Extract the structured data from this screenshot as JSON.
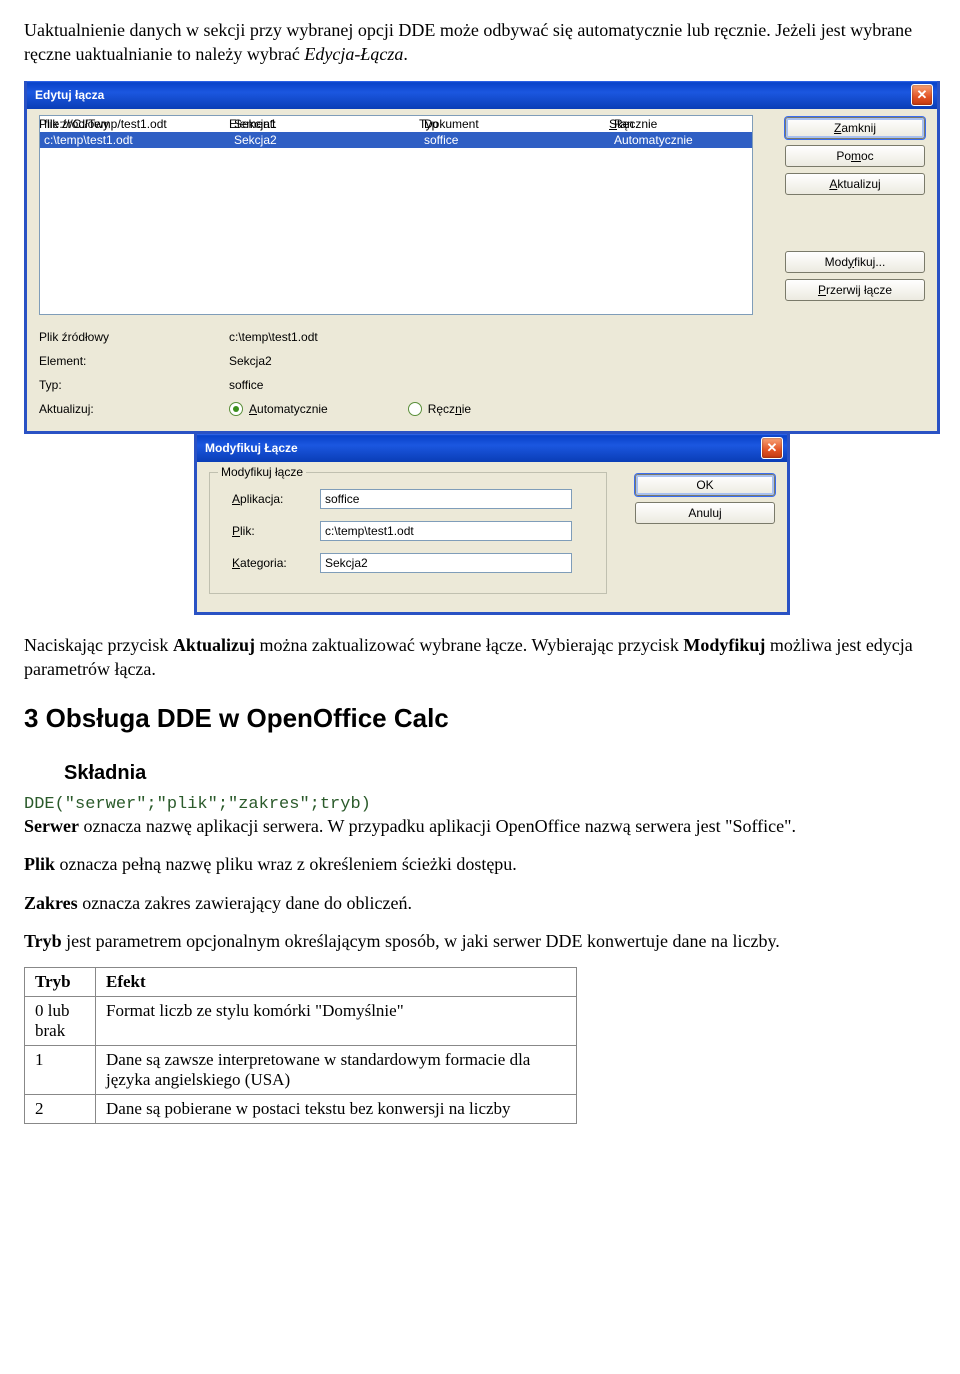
{
  "intro": {
    "p1a": "Uaktualnienie danych w sekcji przy wybranej opcji DDE może odbywać się automatycznie lub ręcznie. Jeżeli jest wybrane ręczne uaktualnianie to należy wybrać ",
    "p1b": "Edycja-Łącza",
    "p1c": "."
  },
  "dialog1": {
    "title": "Edytuj łącza",
    "headers": {
      "source": "Plik źródłowy",
      "element": "Element:",
      "typ": "Typ",
      "stan": "Stan"
    },
    "rows": [
      {
        "source": "file:///C:/Temp/test1.odt",
        "element": "Sekcja1",
        "typ": "Dokument",
        "stan": "Ręcznie"
      },
      {
        "source": "c:\\temp\\test1.odt",
        "element": "Sekcja2",
        "typ": "soffice",
        "stan": "Automatycznie"
      }
    ],
    "buttons": {
      "close": "Zamknij",
      "help": "Pomoc",
      "update": "Aktualizuj",
      "modify": "Modyfikuj...",
      "break": "Przerwij łącze"
    },
    "details": {
      "source_label": "Plik źródłowy",
      "source_val": "c:\\temp\\test1.odt",
      "element_label": "Element:",
      "element_val": "Sekcja2",
      "typ_label": "Typ:",
      "typ_val": "soffice",
      "update_label": "Aktualizuj:",
      "radio_auto": "Automatycznie",
      "radio_manual": "Ręcznie"
    }
  },
  "dialog2": {
    "title": "Modyfikuj Łącze",
    "legend": "Modyfikuj łącze",
    "app_label": "Aplikacja:",
    "app_val": "soffice",
    "file_label": "Plik:",
    "file_val": "c:\\temp\\test1.odt",
    "cat_label": "Kategoria:",
    "cat_val": "Sekcja2",
    "ok": "OK",
    "cancel": "Anuluj"
  },
  "after": {
    "p2a": "Naciskając przycisk ",
    "p2b": "Aktualizuj",
    "p2c": " można zaktualizować wybrane łącze. Wybierając przycisk ",
    "p2d": "Modyfikuj",
    "p2e": " możliwa jest edycja parametrów łącza.",
    "h2": "3  Obsługa DDE w OpenOffice Calc",
    "h3": "Składnia",
    "code": "DDE(\"serwer\";\"plik\";\"zakres\";tryb)",
    "p_serwer_a": "Serwer",
    "p_serwer_b": " oznacza nazwę aplikacji serwera. W przypadku aplikacji OpenOffice nazwą serwera jest \"Soffice\".",
    "p_plik_a": "Plik",
    "p_plik_b": " oznacza pełną nazwę pliku wraz z określeniem ścieżki dostępu.",
    "p_zak_a": "Zakres",
    "p_zak_b": " oznacza zakres zawierający dane do obliczeń.",
    "p_tryb_a": "Tryb",
    "p_tryb_b": " jest parametrem opcjonalnym określającym sposób, w jaki serwer DDE konwertuje dane na liczby."
  },
  "table": {
    "th0": "Tryb",
    "th1": "Efekt",
    "r1c0": "0 lub brak",
    "r1c1": "Format liczb ze stylu komórki \"Domyślnie\"",
    "r2c0": "1",
    "r2c1": "Dane są zawsze interpretowane w standardowym formacie dla języka angielskiego (USA)",
    "r3c0": "2",
    "r3c1": "Dane są pobierane w postaci tekstu bez konwersji na liczby"
  }
}
